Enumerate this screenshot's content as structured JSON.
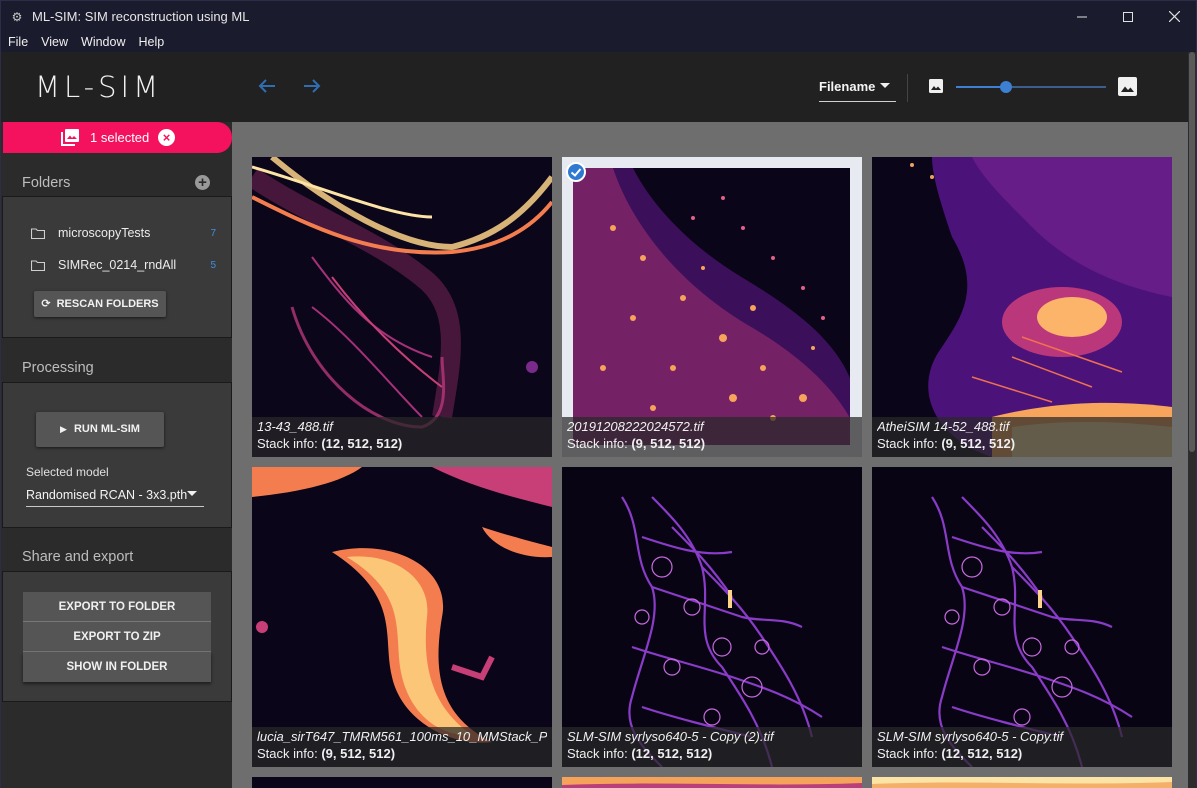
{
  "window": {
    "title": "ML-SIM: SIM reconstruction using ML"
  },
  "menu": [
    "File",
    "View",
    "Window",
    "Help"
  ],
  "header": {
    "logo": "ML-SIM",
    "sort_label": "Filename",
    "thumb_size_level": 0.33
  },
  "selection": {
    "label": "1 selected"
  },
  "folders": {
    "title": "Folders",
    "items": [
      {
        "name": "microscopyTests",
        "count": "7"
      },
      {
        "name": "SIMRec_0214_rndAll",
        "count": "5"
      }
    ],
    "rescan_label": "RESCAN FOLDERS"
  },
  "processing": {
    "title": "Processing",
    "run_label": "RUN ML-SIM",
    "model_label": "Selected model",
    "model_value": "Randomised RCAN - 3x3.pth"
  },
  "export": {
    "title": "Share and export",
    "buttons": [
      "EXPORT TO FOLDER",
      "EXPORT TO ZIP",
      "SHOW IN FOLDER"
    ]
  },
  "gallery": {
    "info_prefix": "Stack info: ",
    "tiles": [
      {
        "filename": "13-43_488.tif",
        "stack": "(12, 512, 512)",
        "selected": false
      },
      {
        "filename": "20191208222024572.tif",
        "stack": "(9, 512, 512)",
        "selected": true
      },
      {
        "filename": "AtheiSIM 14-52_488.tif",
        "stack": "(9, 512, 512)",
        "selected": false
      },
      {
        "filename": "lucia_sirT647_TMRM561_100ms_10_MMStack_P",
        "stack": "(9, 512, 512)",
        "selected": false
      },
      {
        "filename": "SLM-SIM syrlyso640-5 - Copy (2).tif",
        "stack": "(12, 512, 512)",
        "selected": false
      },
      {
        "filename": "SLM-SIM syrlyso640-5 - Copy.tif",
        "stack": "(12, 512, 512)",
        "selected": false
      }
    ]
  },
  "colors": {
    "accent": "#f4115e",
    "link_blue": "#3d8fe0",
    "inferno_hot": "#fcd38b",
    "inferno_mid": "#d6417c",
    "inferno_low": "#3a0e6e"
  }
}
